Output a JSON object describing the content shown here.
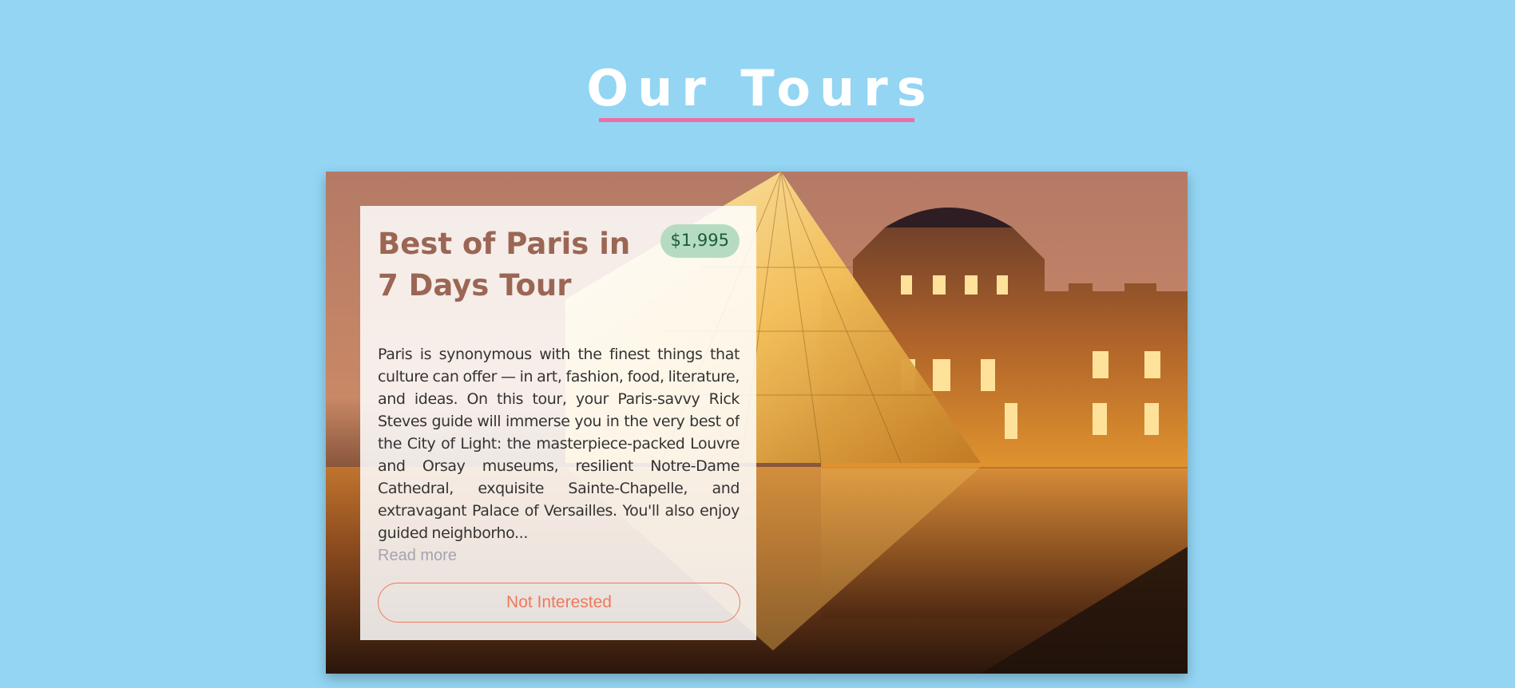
{
  "page": {
    "title": "Our Tours",
    "background_color": "#93d5f3",
    "title_underline_color": "#f06ba7"
  },
  "tours": [
    {
      "name": "Best of Paris in 7 Days Tour",
      "price": "$1,995",
      "image": "louvre-pyramid-at-night",
      "description": "Paris is synonymous with the finest things that culture can offer — in art, fashion, food, literature, and ideas. On this tour, your Paris-savvy Rick Steves guide will immerse you in the very best of the City of Light: the masterpiece-packed Louvre and Orsay museums, resilient Notre-Dame Cathedral, exquisite Sainte-Chapelle, and extravagant Palace of Versailles. You'll also enjoy guided neighborho...",
      "read_more_label": "Read more",
      "not_interested_label": "Not Interested",
      "colors": {
        "title": "#9b6654",
        "price_badge_bg": "#b5dcc2",
        "price_badge_text": "#1d5b3a",
        "button": "#ed7a5a"
      }
    }
  ]
}
